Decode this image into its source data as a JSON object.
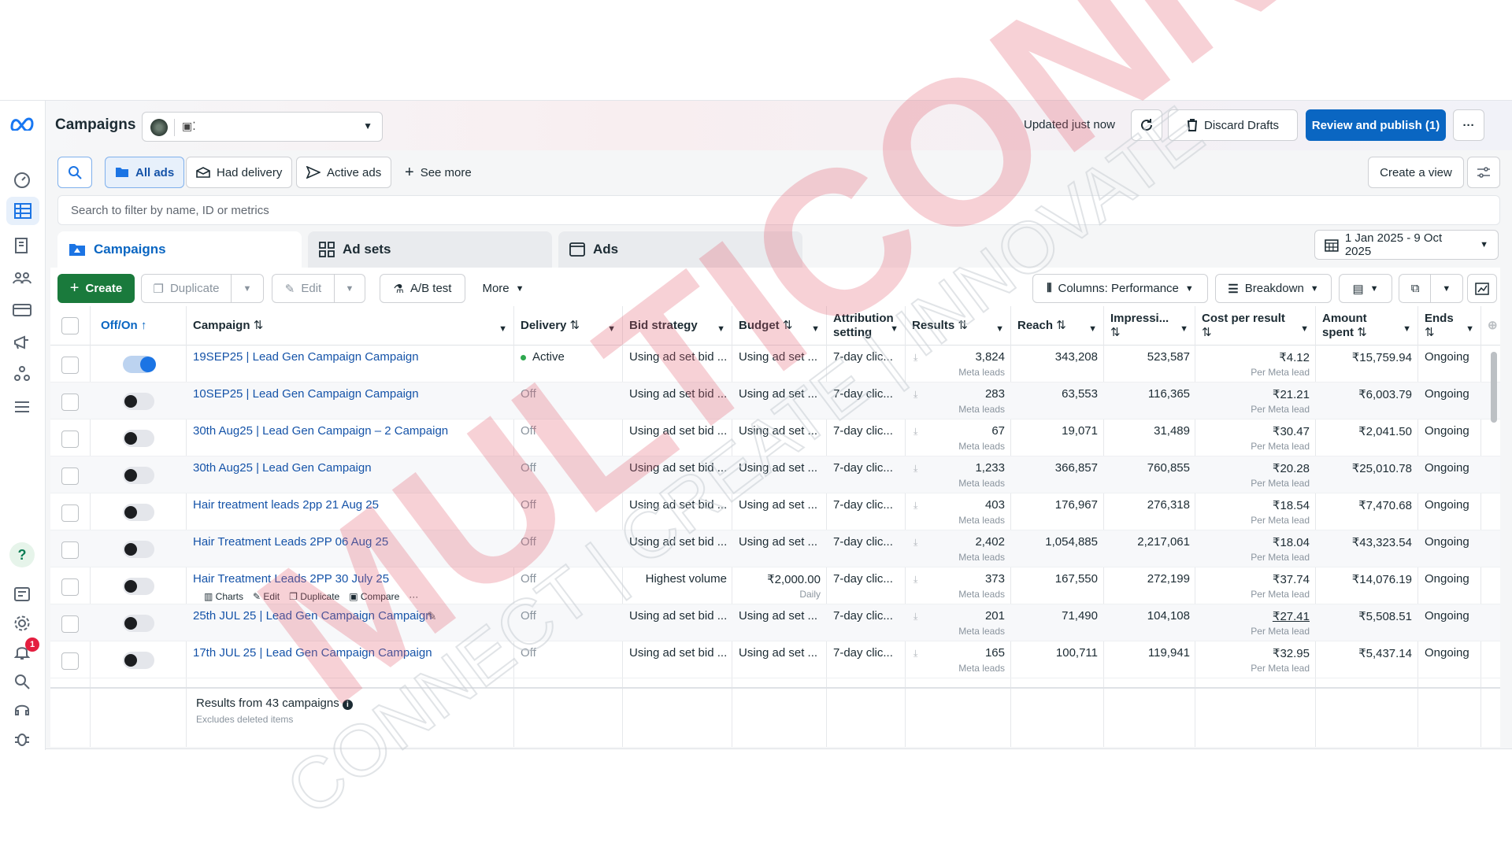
{
  "header": {
    "title": "Campaigns",
    "account_label": "",
    "updated": "Updated just now",
    "discard": "Discard Drafts",
    "publish": "Review and publish (1)",
    "more": "···"
  },
  "filters": {
    "all_ads": "All ads",
    "had_delivery": "Had delivery",
    "active_ads": "Active ads",
    "see_more": "See more",
    "create_view": "Create a view"
  },
  "search": {
    "placeholder": "Search to filter by name, ID or metrics"
  },
  "level_tabs": {
    "campaigns": "Campaigns",
    "ad_sets": "Ad sets",
    "ads": "Ads"
  },
  "date_range": "1 Jan 2025 - 9 Oct 2025",
  "toolbar": {
    "create": "Create",
    "duplicate": "Duplicate",
    "edit": "Edit",
    "ab_test": "A/B test",
    "more": "More",
    "columns": "Columns: Performance",
    "breakdown": "Breakdown"
  },
  "columns": {
    "offon": "Off/On",
    "campaign": "Campaign",
    "delivery": "Delivery",
    "bid": "Bid strategy",
    "budget": "Budget",
    "attribution_1": "Attribution",
    "attribution_2": "setting",
    "results": "Results",
    "reach": "Reach",
    "impressions": "Impressi...",
    "cpr": "Cost per result",
    "amount_1": "Amount",
    "amount_2": "spent",
    "ends": "Ends"
  },
  "rows": [
    {
      "on": true,
      "name": "19SEP25 | Lead Gen Campaign Campaign",
      "delivery": "Active",
      "bid": "Using ad set bid ...",
      "budget": "Using ad set ...",
      "budget_sub": "",
      "attr": "7-day clic...",
      "results": "3,824",
      "results_sub": "Meta leads",
      "reach": "343,208",
      "impr": "523,587",
      "cpr": "₹4.12",
      "cpr_sub": "Per Meta lead",
      "spent": "₹15,759.94",
      "ends": "Ongoing"
    },
    {
      "on": false,
      "name": "10SEP25 | Lead Gen Campaign Campaign",
      "delivery": "Off",
      "bid": "Using ad set bid ...",
      "budget": "Using ad set ...",
      "budget_sub": "",
      "attr": "7-day clic...",
      "results": "283",
      "results_sub": "Meta leads",
      "reach": "63,553",
      "impr": "116,365",
      "cpr": "₹21.21",
      "cpr_sub": "Per Meta lead",
      "spent": "₹6,003.79",
      "ends": "Ongoing"
    },
    {
      "on": false,
      "name": "30th Aug25 | Lead Gen Campaign – 2 Campaign",
      "delivery": "Off",
      "bid": "Using ad set bid ...",
      "budget": "Using ad set ...",
      "budget_sub": "",
      "attr": "7-day clic...",
      "results": "67",
      "results_sub": "Meta leads",
      "reach": "19,071",
      "impr": "31,489",
      "cpr": "₹30.47",
      "cpr_sub": "Per Meta lead",
      "spent": "₹2,041.50",
      "ends": "Ongoing"
    },
    {
      "on": false,
      "name": "30th Aug25 | Lead Gen Campaign",
      "delivery": "Off",
      "bid": "Using ad set bid ...",
      "budget": "Using ad set ...",
      "budget_sub": "",
      "attr": "7-day clic...",
      "results": "1,233",
      "results_sub": "Meta leads",
      "reach": "366,857",
      "impr": "760,855",
      "cpr": "₹20.28",
      "cpr_sub": "Per Meta lead",
      "spent": "₹25,010.78",
      "ends": "Ongoing"
    },
    {
      "on": false,
      "name": "Hair treatment leads 2pp 21 Aug 25",
      "delivery": "Off",
      "bid": "Using ad set bid ...",
      "budget": "Using ad set ...",
      "budget_sub": "",
      "attr": "7-day clic...",
      "results": "403",
      "results_sub": "Meta leads",
      "reach": "176,967",
      "impr": "276,318",
      "cpr": "₹18.54",
      "cpr_sub": "Per Meta lead",
      "spent": "₹7,470.68",
      "ends": "Ongoing"
    },
    {
      "on": false,
      "name": "Hair Treatment Leads 2PP 06 Aug 25",
      "delivery": "Off",
      "bid": "Using ad set bid ...",
      "budget": "Using ad set ...",
      "budget_sub": "",
      "attr": "7-day clic...",
      "results": "2,402",
      "results_sub": "Meta leads",
      "reach": "1,054,885",
      "impr": "2,217,061",
      "cpr": "₹18.04",
      "cpr_sub": "Per Meta lead",
      "spent": "₹43,323.54",
      "ends": "Ongoing"
    },
    {
      "on": false,
      "name": "Hair Treatment Leads 2PP 30 July 25",
      "delivery": "Off",
      "bid": "Highest volume",
      "budget": "₹2,000.00",
      "budget_sub": "Daily",
      "attr": "7-day clic...",
      "results": "373",
      "results_sub": "Meta leads",
      "reach": "167,550",
      "impr": "272,199",
      "cpr": "₹37.74",
      "cpr_sub": "Per Meta lead",
      "spent": "₹14,076.19",
      "ends": "Ongoing"
    },
    {
      "on": false,
      "name": "25th JUL 25 | Lead Gen Campaign Campaign",
      "delivery": "Off",
      "bid": "Using ad set bid ...",
      "budget": "Using ad set ...",
      "budget_sub": "",
      "attr": "7-day clic...",
      "results": "201",
      "results_sub": "Meta leads",
      "reach": "71,490",
      "impr": "104,108",
      "cpr": "₹27.41",
      "cpr_sub": "Per Meta lead",
      "spent": "₹5,508.51",
      "ends": "Ongoing"
    },
    {
      "on": false,
      "name": "17th JUL 25 | Lead Gen Campaign Campaign",
      "delivery": "Off",
      "bid": "Using ad set bid ...",
      "budget": "Using ad set ...",
      "budget_sub": "",
      "attr": "7-day clic...",
      "results": "165",
      "results_sub": "Meta leads",
      "reach": "100,711",
      "impr": "119,941",
      "cpr": "₹32.95",
      "cpr_sub": "Per Meta lead",
      "spent": "₹5,437.14",
      "ends": "Ongoing"
    }
  ],
  "row_actions": {
    "charts": "Charts",
    "edit": "Edit",
    "duplicate": "Duplicate",
    "compare": "Compare",
    "more": "···"
  },
  "footer": {
    "title": "Results from 43 campaigns",
    "subtitle": "Excludes deleted items"
  },
  "notifications_count": "1",
  "watermark": {
    "main": "MULTICONN",
    "tagline": "CONNECT | CREATE | INNOVATE"
  },
  "colors": {
    "primary": "#0a66c2",
    "create": "#1a7a3c",
    "watermark": "#e8a0a8"
  }
}
